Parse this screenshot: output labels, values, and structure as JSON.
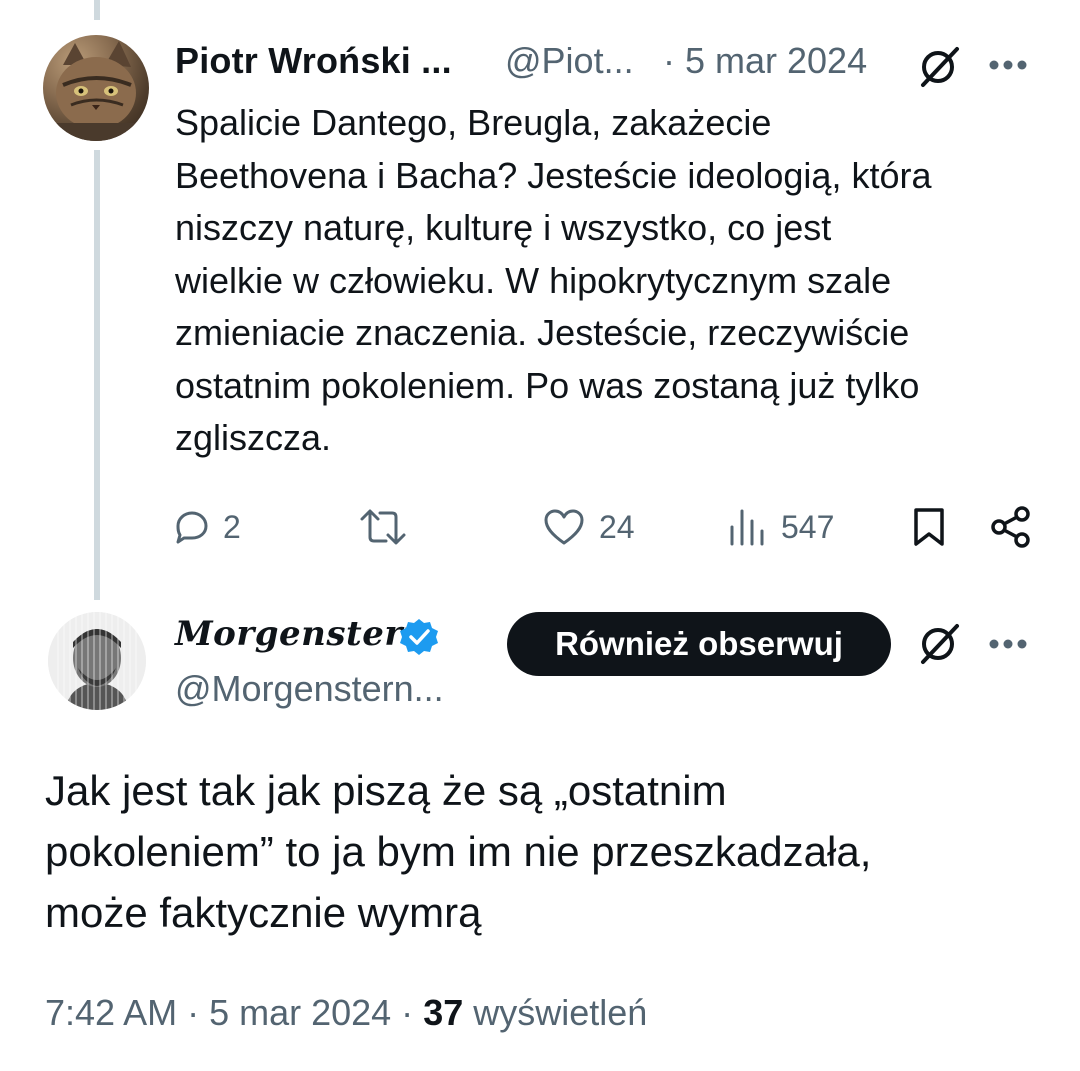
{
  "original_tweet": {
    "author_name": "Piotr Wroński ...",
    "author_handle": "@Piot...",
    "date": "· 5 mar 2024",
    "text": "Spalicie Dantego, Breugla, zakażecie Beethovena i Bacha? Jesteście ideologią, która niszczy naturę, kulturę i wszystko, co jest wielkie w człowieku. W hipokrytycznym szale zmieniacie znaczenia. Jesteście, rzeczywiście ostatnim pokoleniem. Po was zostaną już tylko zgliszcza.",
    "text_lines": [
      "Spalicie Dantego, Breugla, zakażecie",
      "Beethovena i Bacha? Jesteście ideologią, która",
      "niszczy naturę, kulturę i wszystko, co jest",
      "wielkie w człowieku. W hipokrytycznym szale",
      "zmieniacie znaczenia. Jesteście, rzeczywiście",
      "ostatnim pokoleniem. Po was zostaną już tylko",
      "zgliszcza."
    ],
    "actions": {
      "replies": "2",
      "reposts": "",
      "likes": "24",
      "views": "547"
    },
    "icons": [
      "grok-icon",
      "more-icon",
      "reply-icon",
      "repost-icon",
      "like-icon",
      "views-icon",
      "bookmark-icon",
      "share-icon"
    ]
  },
  "reply_tweet": {
    "author_name": "Morgenstern",
    "author_handle": "@Morgenstern...",
    "verified": true,
    "follow_button_label": "Również obserwuj",
    "text_lines": [
      "Jak jest tak jak piszą że są „ostatnim",
      "pokoleniem” to ja bym im nie przeszkadzała,",
      "może faktycznie wymrą"
    ],
    "time": "7:42 AM · 5 mar 2024 ·",
    "views_count": "37",
    "views_label": "wyświetleń"
  },
  "colors": {
    "text": "#0f1419",
    "secondary": "#536471",
    "thread_line": "#cfd9de",
    "verified_blue": "#1d9bf0",
    "follow_button_bg": "#0f1419"
  }
}
